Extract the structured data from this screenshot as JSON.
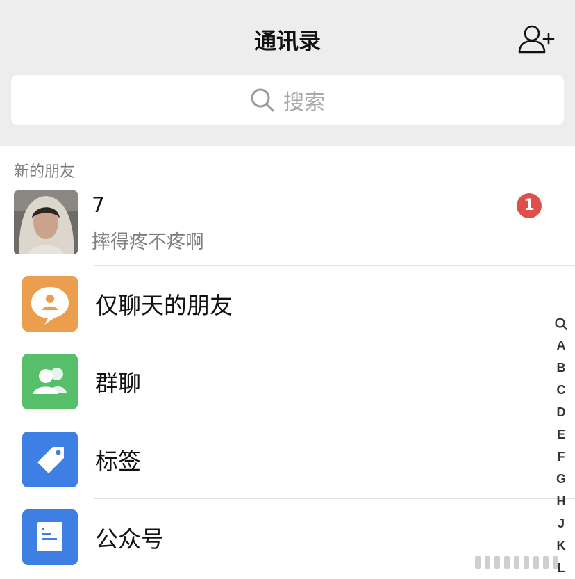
{
  "header": {
    "title": "通讯录",
    "add_icon": "add-friend-icon"
  },
  "search": {
    "placeholder": "搜索",
    "icon": "search-icon"
  },
  "new_friends": {
    "section_label": "新的朋友",
    "name": "7",
    "message": "摔得疼不疼啊",
    "badge_count": "1",
    "badge_color": "#e0504a"
  },
  "menu": [
    {
      "label": "仅聊天的朋友",
      "icon": "chat-only-friends-icon",
      "color": "#eb9f4e"
    },
    {
      "label": "群聊",
      "icon": "group-chat-icon",
      "color": "#57be6a"
    },
    {
      "label": "标签",
      "icon": "tag-icon",
      "color": "#3d7fe3"
    },
    {
      "label": "公众号",
      "icon": "official-account-icon",
      "color": "#3d7fe3"
    }
  ],
  "index_letters": [
    "A",
    "B",
    "C",
    "D",
    "E",
    "F",
    "G",
    "H",
    "J",
    "K",
    "L"
  ],
  "index_search_icon": "search-icon"
}
